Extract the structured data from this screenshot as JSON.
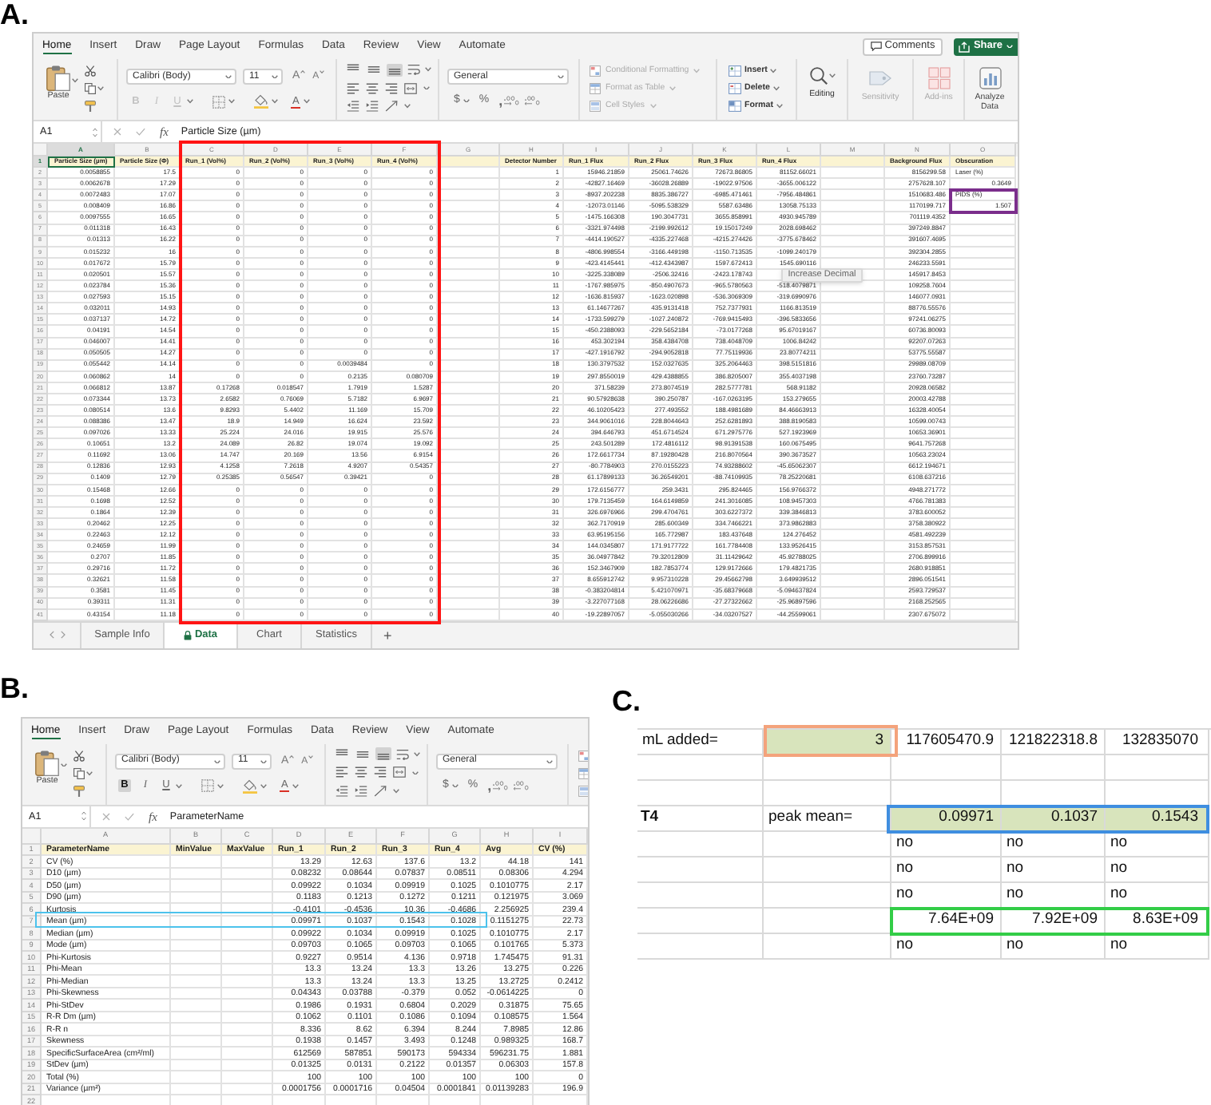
{
  "panel_a": {
    "label": "A.",
    "ribbon_tabs": [
      {
        "label": "Home",
        "selected": true
      },
      {
        "label": "Insert",
        "selected": false
      },
      {
        "label": "Draw",
        "selected": false
      },
      {
        "label": "Page Layout",
        "selected": false
      },
      {
        "label": "Formulas",
        "selected": false
      },
      {
        "label": "Data",
        "selected": false
      },
      {
        "label": "Review",
        "selected": false
      },
      {
        "label": "View",
        "selected": false
      },
      {
        "label": "Automate",
        "selected": false
      }
    ],
    "comments_button": "Comments",
    "share_button": "Share",
    "ribbon": {
      "paste": "Paste",
      "font_name": "Calibri (Body)",
      "font_size": "11",
      "grow_font": "A",
      "shrink_font": "A",
      "format_buttons": [
        {
          "label": "B",
          "on": false,
          "disabled": true
        },
        {
          "label": "I",
          "on": false,
          "disabled": true
        },
        {
          "label": "U",
          "on": false,
          "disabled": true
        }
      ],
      "font_color": "A",
      "vertical_alignment": [
        {
          "selected": false
        },
        {
          "selected": false
        },
        {
          "selected": true
        }
      ],
      "number_format": "General",
      "currency": "$",
      "percent": "%",
      "comma": ",",
      "styles": [
        {
          "label": "Conditional Formatting",
          "disabled": true
        },
        {
          "label": "Format as Table",
          "disabled": true
        },
        {
          "label": "Cell Styles",
          "disabled": true
        }
      ],
      "cells": [
        "Insert",
        "Delete",
        "Format"
      ],
      "editing": "Editing",
      "tools": [
        {
          "label": "Sensitivity",
          "disabled": true
        },
        {
          "label": "Add-ins",
          "disabled": true
        },
        {
          "label": "Analyze Data",
          "disabled": false
        }
      ]
    },
    "name_box": "A1",
    "fx_label": "fx",
    "formula": "Particle Size (µm)",
    "columns": [
      {
        "letter": "A",
        "selected": true
      },
      {
        "letter": "B",
        "selected": false
      },
      {
        "letter": "C",
        "selected": false
      },
      {
        "letter": "D",
        "selected": false
      },
      {
        "letter": "E",
        "selected": false
      },
      {
        "letter": "F",
        "selected": false
      },
      {
        "letter": "G",
        "selected": false
      },
      {
        "letter": "H",
        "selected": false
      },
      {
        "letter": "I",
        "selected": false
      },
      {
        "letter": "J",
        "selected": false
      },
      {
        "letter": "K",
        "selected": false
      },
      {
        "letter": "L",
        "selected": false
      },
      {
        "letter": "M",
        "selected": false
      },
      {
        "letter": "N",
        "selected": false
      },
      {
        "letter": "O",
        "selected": false
      }
    ],
    "header_row": {
      "number": "1",
      "selected": true,
      "cells": [
        "Particle Size (µm)",
        "Particle Size (Φ)",
        "Run_1 (Vol%)",
        "Run_2 (Vol%)",
        "Run_3 (Vol%)",
        "Run_4 (Vol%)",
        null,
        "Detector Number",
        "Run_1 Flux",
        "Run_2 Flux",
        "Run_3 Flux",
        "Run_4 Flux",
        null,
        "Background Flux",
        "Obscuration"
      ]
    },
    "rows": [
      {
        "number": "2",
        "selected": false,
        "cells": [
          "0.0058855",
          "17.5",
          "0",
          "0",
          "0",
          "0",
          null,
          "1",
          "15946.21859",
          "25061.74626",
          "72673.86805",
          "81152.66021",
          null,
          "8156299.58",
          {
            "kind": "text",
            "text": "Laser (%)"
          }
        ]
      },
      {
        "number": "3",
        "selected": false,
        "cells": [
          "0.0062678",
          "17.29",
          "0",
          "0",
          "0",
          "0",
          null,
          "2",
          "-42827.16469",
          "-36028.26889",
          "-19022.97506",
          "-3655.006122",
          null,
          "2757628.107",
          "0.3649"
        ]
      },
      {
        "number": "4",
        "selected": false,
        "cells": [
          "0.0072483",
          "17.07",
          "0",
          "0",
          "0",
          "0",
          null,
          "3",
          "-8937.202238",
          "8835.386727",
          "-6985.471461",
          "-7956.484861",
          null,
          "1510683.486",
          {
            "kind": "text",
            "text": "PIDS (%)"
          }
        ]
      },
      {
        "number": "5",
        "selected": false,
        "cells": [
          "0.008409",
          "16.86",
          "0",
          "0",
          "0",
          "0",
          null,
          "4",
          "-12073.01146",
          "-5095.538329",
          "5587.63486",
          "13058.75133",
          null,
          "1170199.717",
          "1.507"
        ]
      },
      {
        "number": "6",
        "selected": false,
        "cells": [
          "0.0097555",
          "16.65",
          "0",
          "0",
          "0",
          "0",
          null,
          "5",
          "-1475.166308",
          "190.3047731",
          "3655.858991",
          "4930.945789",
          null,
          "701119.4352",
          null
        ]
      },
      {
        "number": "7",
        "selected": false,
        "cells": [
          "0.011318",
          "16.43",
          "0",
          "0",
          "0",
          "0",
          null,
          "6",
          "-3321.974498",
          "-2199.992612",
          "19.15017249",
          "2028.698462",
          null,
          "397249.8847",
          null
        ]
      },
      {
        "number": "8",
        "selected": false,
        "cells": [
          "0.01313",
          "16.22",
          "0",
          "0",
          "0",
          "0",
          null,
          "7",
          "-4414.190527",
          "-4335.227468",
          "-4215.274426",
          "-3775.678462",
          null,
          "391607.4695",
          null
        ]
      },
      {
        "number": "9",
        "selected": false,
        "cells": [
          "0.015232",
          "16",
          "0",
          "0",
          "0",
          "0",
          null,
          "8",
          "-4806.998554",
          "-3166.449198",
          "-1150.713535",
          "-1099.240179",
          null,
          "392304.2855",
          null
        ]
      },
      {
        "number": "10",
        "selected": false,
        "cells": [
          "0.017672",
          "15.79",
          "0",
          "0",
          "0",
          "0",
          null,
          "9",
          "-423.4145441",
          "-412.4343987",
          "1597.672413",
          "1545.690116",
          null,
          "246233.5591",
          null
        ]
      },
      {
        "number": "11",
        "selected": false,
        "cells": [
          "0.020501",
          "15.57",
          "0",
          "0",
          "0",
          "0",
          null,
          "10",
          "-3225.338089",
          "-2506.32416",
          "-2423.178743",
          null,
          null,
          "145917.8453",
          null
        ]
      },
      {
        "number": "12",
        "selected": false,
        "cells": [
          "0.023784",
          "15.36",
          "0",
          "0",
          "0",
          "0",
          null,
          "11",
          "-1767.985975",
          "-850.4907673",
          "-965.5780563",
          "-518.4079871",
          null,
          "109258.7604",
          null
        ]
      },
      {
        "number": "13",
        "selected": false,
        "cells": [
          "0.027593",
          "15.15",
          "0",
          "0",
          "0",
          "0",
          null,
          "12",
          "-1636.815937",
          "-1623.020898",
          "-536.3069309",
          "-319.6990976",
          null,
          "146077.0931",
          null
        ]
      },
      {
        "number": "14",
        "selected": false,
        "cells": [
          "0.032011",
          "14.93",
          "0",
          "0",
          "0",
          "0",
          null,
          "13",
          "61.14677267",
          "435.9131418",
          "752.7377931",
          "1166.813519",
          null,
          "88776.55576",
          null
        ]
      },
      {
        "number": "15",
        "selected": false,
        "cells": [
          "0.037137",
          "14.72",
          "0",
          "0",
          "0",
          "0",
          null,
          "14",
          "-1733.599279",
          "-1027.240872",
          "-769.9415493",
          "-396.5833656",
          null,
          "97241.06275",
          null
        ]
      },
      {
        "number": "16",
        "selected": false,
        "cells": [
          "0.04191",
          "14.54",
          "0",
          "0",
          "0",
          "0",
          null,
          "15",
          "-450.2388093",
          "-229.5652184",
          "-73.0177268",
          "95.67019167",
          null,
          "60736.80093",
          null
        ]
      },
      {
        "number": "17",
        "selected": false,
        "cells": [
          "0.046007",
          "14.41",
          "0",
          "0",
          "0",
          "0",
          null,
          "16",
          "453.302194",
          "358.4384708",
          "738.4048709",
          "1006.84242",
          null,
          "92207.07263",
          null
        ]
      },
      {
        "number": "18",
        "selected": false,
        "cells": [
          "0.050505",
          "14.27",
          "0",
          "0",
          "0",
          "0",
          null,
          "17",
          "-427.1916792",
          "-294.9052818",
          "77.75119936",
          "23.80774211",
          null,
          "53775.55587",
          null
        ]
      },
      {
        "number": "19",
        "selected": false,
        "cells": [
          "0.055442",
          "14.14",
          "0",
          "0",
          "0.0039484",
          "0",
          null,
          "18",
          "130.3797532",
          "152.0327635",
          "325.2064463",
          "398.5151816",
          null,
          "29989.08709",
          null
        ]
      },
      {
        "number": "20",
        "selected": false,
        "cells": [
          "0.060862",
          "14",
          "0",
          "0",
          "0.2135",
          "0.080709",
          null,
          "19",
          "297.8550019",
          "429.4388855",
          "386.8205007",
          "355.4037198",
          null,
          "23760.73287",
          null
        ]
      },
      {
        "number": "21",
        "selected": false,
        "cells": [
          "0.066812",
          "13.87",
          "0.17268",
          "0.018547",
          "1.7919",
          "1.5287",
          null,
          "20",
          "371.58239",
          "273.8074519",
          "282.5777781",
          "568.91182",
          null,
          "20928.06582",
          null
        ]
      },
      {
        "number": "22",
        "selected": false,
        "cells": [
          "0.073344",
          "13.73",
          "2.6582",
          "0.76069",
          "5.7182",
          "6.9697",
          null,
          "21",
          "90.57928638",
          "390.250787",
          "-167.0263195",
          "153.279655",
          null,
          "20003.42788",
          null
        ]
      },
      {
        "number": "23",
        "selected": false,
        "cells": [
          "0.080514",
          "13.6",
          "9.8293",
          "5.4402",
          "11.169",
          "15.709",
          null,
          "22",
          "46.10205423",
          "277.493552",
          "188.4981689",
          "84.46663913",
          null,
          "16328.40054",
          null
        ]
      },
      {
        "number": "24",
        "selected": false,
        "cells": [
          "0.088386",
          "13.47",
          "18.9",
          "14.949",
          "16.624",
          "23.592",
          null,
          "23",
          "344.9061016",
          "228.8044643",
          "252.6281893",
          "388.8190583",
          null,
          "10599.00743",
          null
        ]
      },
      {
        "number": "25",
        "selected": false,
        "cells": [
          "0.097026",
          "13.33",
          "25.224",
          "24.016",
          "19.915",
          "25.576",
          null,
          "24",
          "394.646793",
          "451.6714524",
          "671.2975776",
          "527.1923969",
          null,
          "10653.36901",
          null
        ]
      },
      {
        "number": "26",
        "selected": false,
        "cells": [
          "0.10651",
          "13.2",
          "24.089",
          "26.82",
          "19.074",
          "19.092",
          null,
          "25",
          "243.501289",
          "172.4816112",
          "98.91391538",
          "160.0675495",
          null,
          "9641.757268",
          null
        ]
      },
      {
        "number": "27",
        "selected": false,
        "cells": [
          "0.11692",
          "13.06",
          "14.747",
          "20.169",
          "13.56",
          "6.9154",
          null,
          "26",
          "172.6617734",
          "87.19280428",
          "216.8070564",
          "390.3673527",
          null,
          "10563.23024",
          null
        ]
      },
      {
        "number": "28",
        "selected": false,
        "cells": [
          "0.12836",
          "12.93",
          "4.1258",
          "7.2618",
          "4.9207",
          "0.54357",
          null,
          "27",
          "-80.7784903",
          "270.0155223",
          "74.93288602",
          "-45.65062307",
          null,
          "6612.194671",
          null
        ]
      },
      {
        "number": "29",
        "selected": false,
        "cells": [
          "0.1409",
          "12.79",
          "0.25385",
          "0.56547",
          "0.39421",
          "0",
          null,
          "28",
          "61.17899133",
          "36.26549201",
          "-88.74109935",
          "78.25220681",
          null,
          "6108.637216",
          null
        ]
      },
      {
        "number": "30",
        "selected": false,
        "cells": [
          "0.15468",
          "12.66",
          "0",
          "0",
          "0",
          "0",
          null,
          "29",
          "172.6156777",
          "259.3431",
          "295.824465",
          "156.9766372",
          null,
          "4948.271772",
          null
        ]
      },
      {
        "number": "31",
        "selected": false,
        "cells": [
          "0.1698",
          "12.52",
          "0",
          "0",
          "0",
          "0",
          null,
          "30",
          "179.7135459",
          "164.6149859",
          "241.3016085",
          "108.9457303",
          null,
          "4766.781383",
          null
        ]
      },
      {
        "number": "32",
        "selected": false,
        "cells": [
          "0.1864",
          "12.39",
          "0",
          "0",
          "0",
          "0",
          null,
          "31",
          "326.6976966",
          "299.4704761",
          "303.6227372",
          "339.3846813",
          null,
          "3783.600052",
          null
        ]
      },
      {
        "number": "33",
        "selected": false,
        "cells": [
          "0.20462",
          "12.25",
          "0",
          "0",
          "0",
          "0",
          null,
          "32",
          "362.7170919",
          "285.600349",
          "334.7466221",
          "373.9862883",
          null,
          "3758.380922",
          null
        ]
      },
      {
        "number": "34",
        "selected": false,
        "cells": [
          "0.22463",
          "12.12",
          "0",
          "0",
          "0",
          "0",
          null,
          "33",
          "63.95195156",
          "165.772987",
          "183.437648",
          "124.276452",
          null,
          "4581.492239",
          null
        ]
      },
      {
        "number": "35",
        "selected": false,
        "cells": [
          "0.24659",
          "11.99",
          "0",
          "0",
          "0",
          "0",
          null,
          "34",
          "144.0345807",
          "171.9177722",
          "161.7784408",
          "133.9526415",
          null,
          "3153.857531",
          null
        ]
      },
      {
        "number": "36",
        "selected": false,
        "cells": [
          "0.2707",
          "11.85",
          "0",
          "0",
          "0",
          "0",
          null,
          "35",
          "36.04977842",
          "79.32012809",
          "31.11429642",
          "45.92788025",
          null,
          "2706.899916",
          null
        ]
      },
      {
        "number": "37",
        "selected": false,
        "cells": [
          "0.29716",
          "11.72",
          "0",
          "0",
          "0",
          "0",
          null,
          "36",
          "152.3467909",
          "182.7853774",
          "129.9172666",
          "179.4821735",
          null,
          "2680.918851",
          null
        ]
      },
      {
        "number": "38",
        "selected": false,
        "cells": [
          "0.32621",
          "11.58",
          "0",
          "0",
          "0",
          "0",
          null,
          "37",
          "8.655912742",
          "9.957310228",
          "29.45662798",
          "3.649939512",
          null,
          "2896.051541",
          null
        ]
      },
      {
        "number": "39",
        "selected": false,
        "cells": [
          "0.3581",
          "11.45",
          "0",
          "0",
          "0",
          "0",
          null,
          "38",
          "-0.383204814",
          "5.421070971",
          "-35.68379668",
          "-5.094637824",
          null,
          "2593.729537",
          null
        ]
      },
      {
        "number": "40",
        "selected": false,
        "cells": [
          "0.39311",
          "11.31",
          "0",
          "0",
          "0",
          "0",
          null,
          "39",
          "-3.227077168",
          "28.06226686",
          "-27.27322662",
          "-25.96897596",
          null,
          "2168.252565",
          null
        ]
      },
      {
        "number": "41",
        "selected": false,
        "cells": [
          "0.43154",
          "11.18",
          "0",
          "0",
          "0",
          "0",
          null,
          "40",
          "-19.22897057",
          "-5.055030266",
          "-34.03207527",
          "-44.25599061",
          null,
          "2307.675072",
          null
        ]
      }
    ],
    "tooltip": "Increase Decimal",
    "sheet_tabs": [
      {
        "label": "Sample Info",
        "selected": false,
        "locked": false
      },
      {
        "label": "Data",
        "selected": true,
        "locked": true
      },
      {
        "label": "Chart",
        "selected": false,
        "locked": false
      },
      {
        "label": "Statistics",
        "selected": false,
        "locked": false
      }
    ],
    "add_sheet": "+",
    "highlights": [
      {
        "color": "#ff1414"
      },
      {
        "color": "#7b2e8c"
      }
    ]
  },
  "panel_b": {
    "label": "B.",
    "ribbon_tabs": [
      {
        "label": "Home",
        "selected": true
      },
      {
        "label": "Insert",
        "selected": false
      },
      {
        "label": "Draw",
        "selected": false
      },
      {
        "label": "Page Layout",
        "selected": false
      },
      {
        "label": "Formulas",
        "selected": false
      },
      {
        "label": "Data",
        "selected": false
      },
      {
        "label": "Review",
        "selected": false
      },
      {
        "label": "View",
        "selected": false
      },
      {
        "label": "Automate",
        "selected": false
      }
    ],
    "ribbon": {
      "paste": "Paste",
      "font_name": "Calibri (Body)",
      "font_size": "11",
      "grow_font": "A",
      "shrink_font": "A",
      "format_buttons": [
        {
          "label": "B",
          "on": true,
          "disabled": false
        },
        {
          "label": "I",
          "on": false,
          "disabled": false
        },
        {
          "label": "U",
          "on": false,
          "disabled": false
        }
      ],
      "font_color": "A",
      "vertical_alignment": [
        {
          "selected": false
        },
        {
          "selected": false
        },
        {
          "selected": true
        }
      ],
      "number_format": "General",
      "currency": "$",
      "percent": "%",
      "comma": ","
    },
    "name_box": "A1",
    "fx_label": "fx",
    "formula": "ParameterName",
    "columns": [
      {
        "letter": "A"
      },
      {
        "letter": "B"
      },
      {
        "letter": "C"
      },
      {
        "letter": "D"
      },
      {
        "letter": "E"
      },
      {
        "letter": "F"
      },
      {
        "letter": "G"
      },
      {
        "letter": "H"
      },
      {
        "letter": "I"
      }
    ],
    "header_row": {
      "number": "1",
      "cells": [
        "ParameterName",
        "MinValue",
        "MaxValue",
        "Run_1",
        "Run_2",
        "Run_3",
        "Run_4",
        "Avg",
        "CV (%)"
      ]
    },
    "rows": [
      {
        "number": "2",
        "cells": [
          "CV (%)",
          null,
          null,
          "13.29",
          "12.63",
          "137.6",
          "13.2",
          "44.18",
          "141"
        ]
      },
      {
        "number": "3",
        "cells": [
          "D10 (µm)",
          null,
          null,
          "0.08232",
          "0.08644",
          "0.07837",
          "0.08511",
          "0.08306",
          "4.294"
        ]
      },
      {
        "number": "4",
        "cells": [
          "D50 (µm)",
          null,
          null,
          "0.09922",
          "0.1034",
          "0.09919",
          "0.1025",
          "0.1010775",
          "2.17"
        ]
      },
      {
        "number": "5",
        "cells": [
          "D90 (µm)",
          null,
          null,
          "0.1183",
          "0.1213",
          "0.1272",
          "0.1211",
          "0.121975",
          "3.069"
        ]
      },
      {
        "number": "6",
        "cells": [
          "Kurtosis",
          null,
          null,
          "-0.4101",
          "-0.4536",
          "10.36",
          "-0.4686",
          "2.256925",
          "239.4"
        ]
      },
      {
        "number": "7",
        "cells": [
          "Mean (µm)",
          null,
          null,
          "0.09971",
          "0.1037",
          "0.1543",
          "0.1028",
          "0.1151275",
          "22.73"
        ]
      },
      {
        "number": "8",
        "cells": [
          "Median (µm)",
          null,
          null,
          "0.09922",
          "0.1034",
          "0.09919",
          "0.1025",
          "0.1010775",
          "2.17"
        ]
      },
      {
        "number": "9",
        "cells": [
          "Mode (µm)",
          null,
          null,
          "0.09703",
          "0.1065",
          "0.09703",
          "0.1065",
          "0.101765",
          "5.373"
        ]
      },
      {
        "number": "10",
        "cells": [
          "Phi-Kurtosis",
          null,
          null,
          "0.9227",
          "0.9514",
          "4.136",
          "0.9718",
          "1.745475",
          "91.31"
        ]
      },
      {
        "number": "11",
        "cells": [
          "Phi-Mean",
          null,
          null,
          "13.3",
          "13.24",
          "13.3",
          "13.26",
          "13.275",
          "0.226"
        ]
      },
      {
        "number": "12",
        "cells": [
          "Phi-Median",
          null,
          null,
          "13.3",
          "13.24",
          "13.3",
          "13.25",
          "13.2725",
          "0.2412"
        ]
      },
      {
        "number": "13",
        "cells": [
          "Phi-Skewness",
          null,
          null,
          "0.04343",
          "0.03788",
          "-0.379",
          "0.052",
          "-0.0614225",
          "0"
        ]
      },
      {
        "number": "14",
        "cells": [
          "Phi-StDev",
          null,
          null,
          "0.1986",
          "0.1931",
          "0.6804",
          "0.2029",
          "0.31875",
          "75.65"
        ]
      },
      {
        "number": "15",
        "cells": [
          "R-R Dm (µm)",
          null,
          null,
          "0.1062",
          "0.1101",
          "0.1086",
          "0.1094",
          "0.108575",
          "1.564"
        ]
      },
      {
        "number": "16",
        "cells": [
          "R-R n",
          null,
          null,
          "8.336",
          "8.62",
          "6.394",
          "8.244",
          "7.8985",
          "12.86"
        ]
      },
      {
        "number": "17",
        "cells": [
          "Skewness",
          null,
          null,
          "0.1938",
          "0.1457",
          "3.493",
          "0.1248",
          "0.989325",
          "168.7"
        ]
      },
      {
        "number": "18",
        "cells": [
          "SpecificSurfaceArea (cm²/ml)",
          null,
          null,
          "612569",
          "587851",
          "590173",
          "594334",
          "596231.75",
          "1.881"
        ]
      },
      {
        "number": "19",
        "cells": [
          "StDev (µm)",
          null,
          null,
          "0.01325",
          "0.0131",
          "0.2122",
          "0.01357",
          "0.06303",
          "157.8"
        ]
      },
      {
        "number": "20",
        "cells": [
          "Total (%)",
          null,
          null,
          "100",
          "100",
          "100",
          "100",
          "100",
          "0"
        ]
      },
      {
        "number": "21",
        "cells": [
          "Variance (µm²)",
          null,
          null,
          "0.0001756",
          "0.0001716",
          "0.04504",
          "0.0001841",
          "0.01139283",
          "196.9"
        ]
      },
      {
        "number": "22",
        "cells": [
          null,
          null,
          null,
          null,
          null,
          null,
          null,
          null,
          null
        ]
      }
    ],
    "highlights": [
      {
        "color": "#4cc2ec"
      }
    ]
  },
  "panel_c": {
    "label": "C.",
    "rows": [
      [
        {
          "kind": "text",
          "text": "mL added=",
          "filled": false
        },
        {
          "kind": "number",
          "text": "3",
          "filled": true
        },
        {
          "kind": "number",
          "text": "117605470.9",
          "filled": false
        },
        {
          "kind": "number",
          "text": "121822318.8",
          "filled": false
        },
        {
          "kind": "number",
          "text": "132835070",
          "filled": false
        }
      ],
      [
        null,
        null,
        null,
        null,
        null
      ],
      [
        null,
        null,
        null,
        null,
        null
      ],
      [
        {
          "kind": "heading",
          "text": "T4",
          "filled": false
        },
        {
          "kind": "text",
          "text": "peak mean=",
          "filled": false
        },
        {
          "kind": "number",
          "text": "0.09971",
          "filled": true
        },
        {
          "kind": "number",
          "text": "0.1037",
          "filled": true
        },
        {
          "kind": "number",
          "text": "0.1543",
          "filled": true
        }
      ],
      [
        null,
        null,
        {
          "kind": "text",
          "text": "no",
          "filled": false
        },
        {
          "kind": "text",
          "text": "no",
          "filled": false
        },
        {
          "kind": "text",
          "text": "no",
          "filled": false
        }
      ],
      [
        null,
        null,
        {
          "kind": "text",
          "text": "no",
          "filled": false
        },
        {
          "kind": "text",
          "text": "no",
          "filled": false
        },
        {
          "kind": "text",
          "text": "no",
          "filled": false
        }
      ],
      [
        null,
        null,
        {
          "kind": "text",
          "text": "no",
          "filled": false
        },
        {
          "kind": "text",
          "text": "no",
          "filled": false
        },
        {
          "kind": "text",
          "text": "no",
          "filled": false
        }
      ],
      [
        null,
        null,
        {
          "kind": "number",
          "text": "7.64E+09",
          "filled": false
        },
        {
          "kind": "number",
          "text": "7.92E+09",
          "filled": false
        },
        {
          "kind": "number",
          "text": "8.63E+09",
          "filled": false
        }
      ],
      [
        null,
        null,
        {
          "kind": "text",
          "text": "no",
          "filled": false
        },
        {
          "kind": "text",
          "text": "no",
          "filled": false
        },
        {
          "kind": "text",
          "text": "no",
          "filled": false
        }
      ]
    ],
    "highlights": [
      {
        "color": "#f4a37c"
      },
      {
        "color": "#3f8ee0"
      },
      {
        "color": "#33cd47"
      }
    ]
  }
}
